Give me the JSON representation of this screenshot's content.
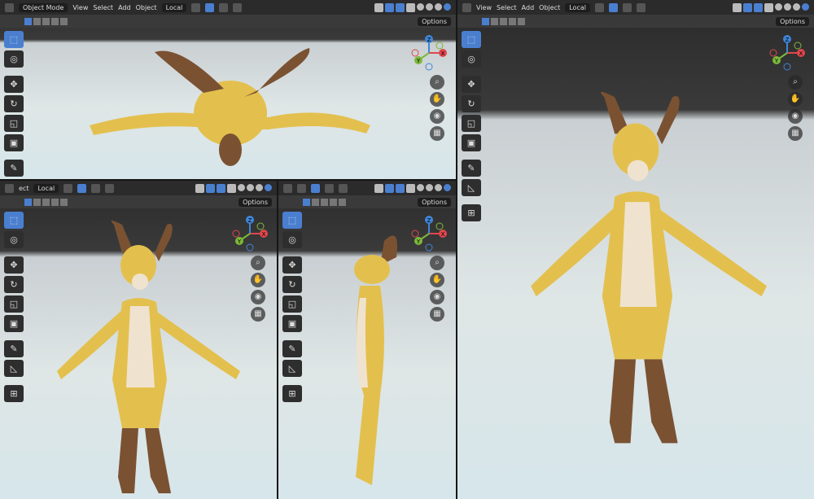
{
  "viewports": [
    {
      "id": "top",
      "mode": "Object Mode",
      "menus": [
        "View",
        "Select",
        "Add",
        "Object"
      ],
      "transform": "Local",
      "options": "Options",
      "view": "top"
    },
    {
      "id": "perspective",
      "mode": "",
      "menus": [
        "View",
        "Select",
        "Add",
        "Object"
      ],
      "transform": "Local",
      "options": "Options",
      "view": "persp"
    },
    {
      "id": "front",
      "mode": "",
      "menus": [
        "ect"
      ],
      "transform": "Local",
      "options": "Options",
      "view": "front"
    },
    {
      "id": "side",
      "mode": "",
      "menus": [],
      "transform": "",
      "options": "Options",
      "view": "side"
    }
  ],
  "tool_icons": [
    "select-box-icon",
    "cursor-icon",
    "move-icon",
    "rotate-icon",
    "scale-icon",
    "transform-icon",
    "annotate-icon",
    "measure-icon",
    "add-cube-icon"
  ],
  "gizmo_labels": {
    "x": "X",
    "y": "Y",
    "z": "Z"
  },
  "colors": {
    "accent": "#4a7fd0",
    "fur": "#e3c04e",
    "dark_fur": "#7a5232",
    "belly": "#efe3cf",
    "x": "#e0474e",
    "y": "#7cb83a",
    "z": "#3f86d8"
  }
}
